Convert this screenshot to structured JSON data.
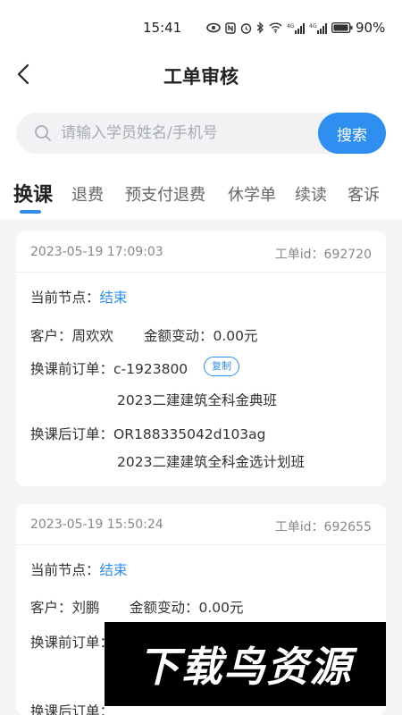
{
  "status_bar": {
    "time": "15:41",
    "battery": "90%"
  },
  "header": {
    "title": "工单审核"
  },
  "search": {
    "placeholder": "请输入学员姓名/手机号",
    "button_label": "搜索"
  },
  "tabs": [
    {
      "label": "换课",
      "active": true
    },
    {
      "label": "退费"
    },
    {
      "label": "预支付退费"
    },
    {
      "label": "休学单"
    },
    {
      "label": "续读"
    },
    {
      "label": "客诉"
    }
  ],
  "labels": {
    "node": "当前节点：",
    "customer": "客户：",
    "amount": "金额变动：",
    "before_order": "换课前订单：",
    "after_order": "换课后订单：",
    "id_prefix": "工单id：",
    "copy": "复制"
  },
  "cards": [
    {
      "time": "2023-05-19 17:09:03",
      "id": "692720",
      "node": "结束",
      "customer": "周欢欢",
      "amount": "0.00元",
      "before_order_no": "c-1923800",
      "before_course": "2023二建建筑全科金典班",
      "after_order_no": "OR188335042d103ag",
      "after_course": "2023二建建筑全科金选计划班"
    },
    {
      "time": "2023-05-19 15:50:24",
      "id": "692655",
      "node": "结束",
      "customer": "刘鹏",
      "amount": "0.00元"
    }
  ],
  "watermark": "下载鸟资源"
}
